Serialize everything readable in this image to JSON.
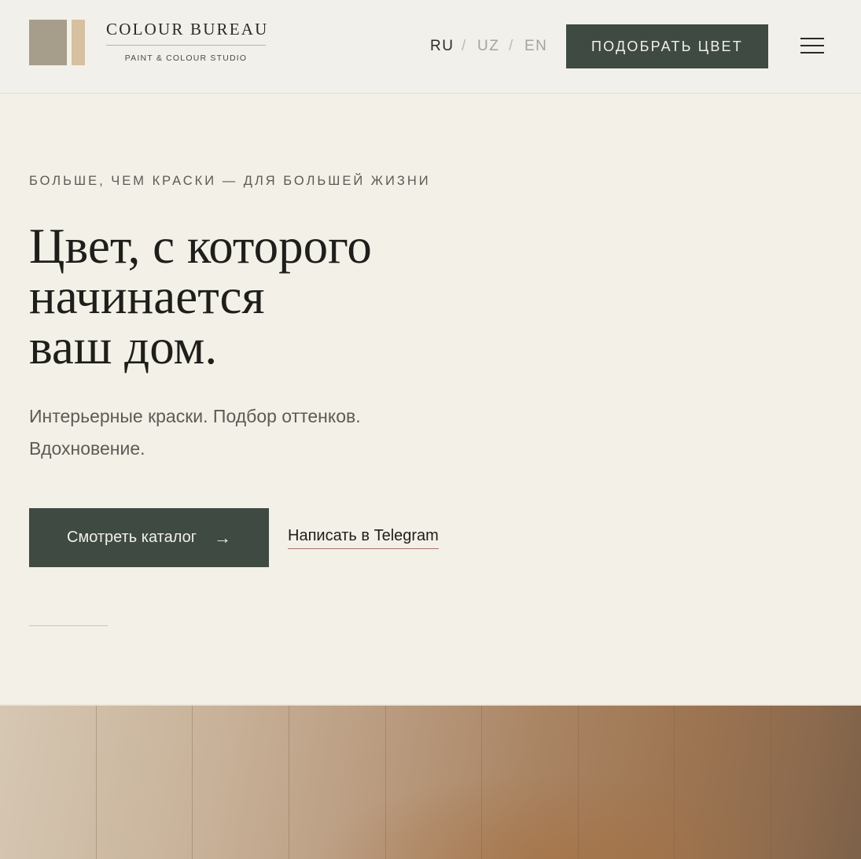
{
  "header": {
    "brand_name": "COLOUR BUREAU",
    "brand_tagline": "PAINT & COLOUR STUDIO",
    "languages": [
      {
        "code": "RU",
        "active": true
      },
      {
        "code": "UZ",
        "active": false
      },
      {
        "code": "EN",
        "active": false
      }
    ],
    "language_separator": "/",
    "cta_label": "ПОДОБРАТЬ ЦВЕТ",
    "menu_icon": "hamburger-icon"
  },
  "hero": {
    "eyebrow": "БОЛЬШЕ, ЧЕМ КРАСКИ — ДЛЯ БОЛЬШЕЙ ЖИЗНИ",
    "title_lines": [
      "Цвет, с которого",
      "начинается",
      "ваш дом."
    ],
    "subtitle_lines": [
      "Интерьерные краски. Подбор оттенков.",
      "Вдохновение."
    ],
    "primary_button_label": "Смотреть каталог",
    "primary_button_icon": "arrow-right-icon",
    "secondary_link_label": "Написать в Telegram"
  },
  "colors": {
    "background": "#f3f0e8",
    "accent_dark_green": "#3e4a42",
    "logo_swatch_1": "#a69e8a",
    "logo_swatch_2": "#d6c09f",
    "link_underline": "#a8706b"
  }
}
